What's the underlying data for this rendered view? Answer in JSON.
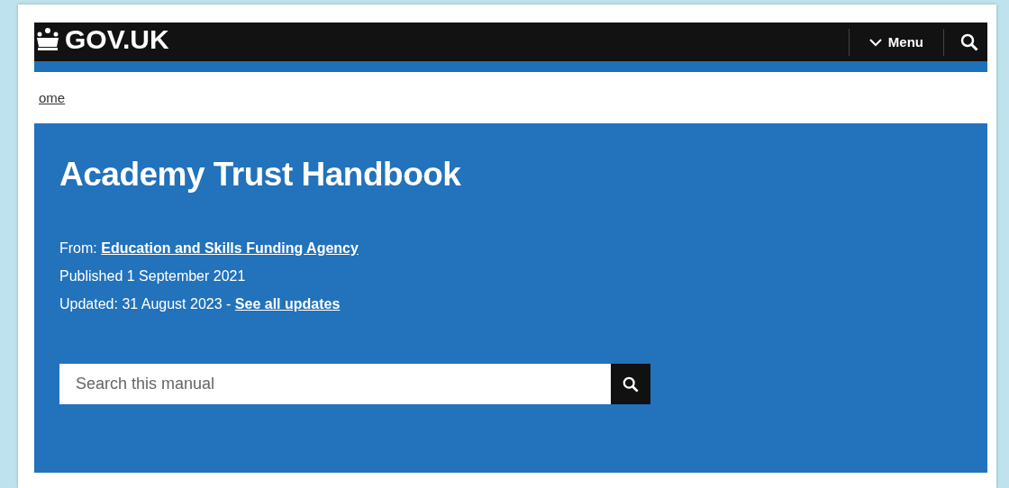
{
  "header": {
    "logo": "GOV.UK",
    "menu_button": "Menu"
  },
  "breadcrumbs": [
    "ome"
  ],
  "hero": {
    "title": "Academy Trust Handbook",
    "from_label": "From:",
    "from_link": "Education and Skills Funding Agency",
    "published": "Published 1 September 2021",
    "updated": "Updated: 31 August 2023 -",
    "updates_link": "See all updates"
  },
  "search": {
    "placeholder": "Search this manual"
  }
}
